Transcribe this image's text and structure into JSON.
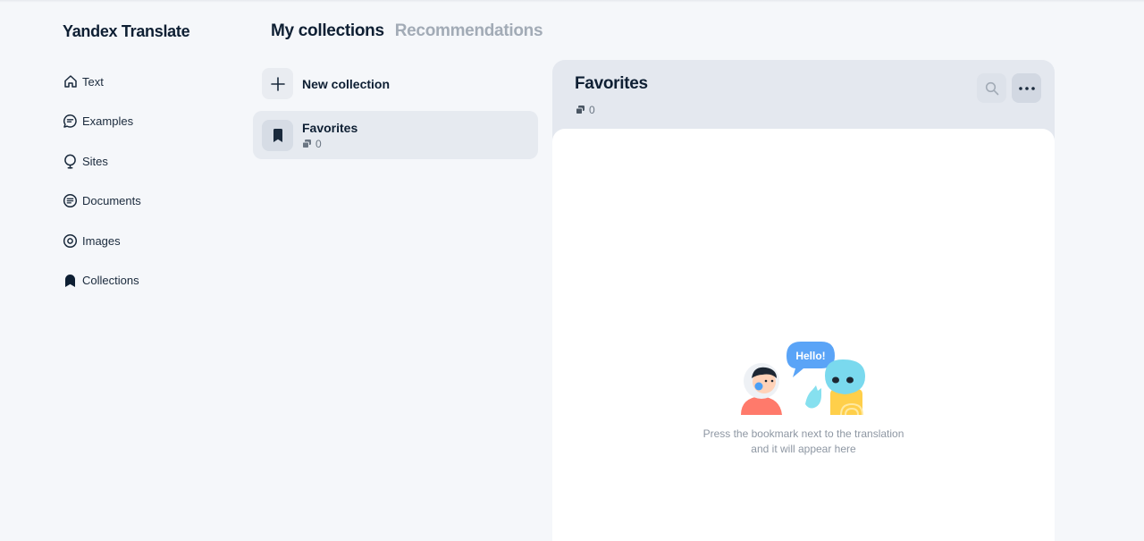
{
  "app": {
    "title": "Yandex Translate"
  },
  "sidebar": {
    "items": [
      {
        "label": "Text",
        "icon": "home-icon"
      },
      {
        "label": "Examples",
        "icon": "chat-bubble-icon"
      },
      {
        "label": "Sites",
        "icon": "globe-pin-icon"
      },
      {
        "label": "Documents",
        "icon": "document-icon"
      },
      {
        "label": "Images",
        "icon": "camera-icon"
      },
      {
        "label": "Collections",
        "icon": "bookmark-icon"
      }
    ]
  },
  "tabs": [
    {
      "label": "My collections",
      "active": true
    },
    {
      "label": "Recommendations",
      "active": false
    }
  ],
  "collections": {
    "new_label": "New collection",
    "items": [
      {
        "name": "Favorites",
        "count": "0",
        "selected": true
      }
    ]
  },
  "panel": {
    "title": "Favorites",
    "count": "0",
    "illustration_bubble": "Hello!",
    "empty_line1": "Press the bookmark next to the translation",
    "empty_line2": "and it will appear here"
  },
  "colors": {
    "background": "#f5f7fa",
    "panel_header": "#e4e8ef",
    "text_primary": "#0e1f33",
    "text_muted": "#a2abb6"
  }
}
